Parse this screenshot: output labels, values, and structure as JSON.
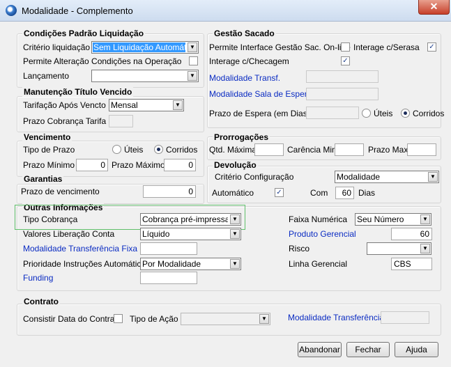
{
  "window": {
    "title": "Modalidade - Complemento",
    "close_glyph": "✕"
  },
  "cond": {
    "title": "Condições Padrão Liquidação",
    "criterio_label": "Critério liquidação",
    "criterio_value": "Sem Liquidação Automática",
    "permite_alteracao_label": "Permite Alteração Condições na Operação",
    "lancamento_label": "Lançamento",
    "lancamento_value": ""
  },
  "manut": {
    "title": "Manutenção Título Vencido",
    "tarifacao_label": "Tarifação Após Vencto",
    "tarifacao_value": "Mensal",
    "prazo_label": "Prazo Cobrança Tarifa",
    "prazo_value": ""
  },
  "venc": {
    "title": "Vencimento",
    "tipo_label": "Tipo de Prazo",
    "uteis_label": "Úteis",
    "corridos_label": "Corridos",
    "prazo_min_label": "Prazo Mínimo",
    "prazo_min_value": "0",
    "prazo_max_label": "Prazo Máximo",
    "prazo_max_value": "0"
  },
  "garantias": {
    "title": "Garantias",
    "prazo_label": "Prazo de vencimento",
    "prazo_value": "0"
  },
  "gestao": {
    "title": "Gestão Sacado",
    "interface_label": "Permite Interface Gestão Sac. On-line",
    "serasa_label": "Interage c/Serasa",
    "checagem_label": "Interage c/Checagem",
    "modalidade_transf_label": "Modalidade Transf.",
    "modalidade_sala_label": "Modalidade Sala de Espera",
    "prazo_espera_label": "Prazo de Espera (em Dias)",
    "uteis_label": "Úteis",
    "corridos_label": "Corridos"
  },
  "prorrog": {
    "title": "Prorrogações",
    "qtd_label": "Qtd. Máxima",
    "carencia_label": "Carência Min.",
    "prazo_label": "Prazo Max."
  },
  "devol": {
    "title": "Devolução",
    "criterio_label": "Critério Configuração",
    "criterio_value": "Modalidade",
    "automatico_label": "Automático",
    "com_label": "Com",
    "com_value": "60",
    "dias_label": "Dias"
  },
  "outras": {
    "title": "Outras Informações",
    "tipo_cobranca_label": "Tipo Cobrança",
    "tipo_cobranca_value": "Cobrança pré-impressa",
    "valores_label": "Valores Liberação Conta",
    "valores_value": "Líquido",
    "modalidade_transf_label": "Modalidade Transferência Fixa",
    "prioridade_label": "Prioridade Instruções Automáticas",
    "prioridade_value": "Por Modalidade",
    "funding_label": "Funding",
    "faixa_label": "Faixa Numérica",
    "faixa_value": "Seu Número",
    "produto_label": "Produto Gerencial",
    "produto_value": "60",
    "risco_label": "Risco",
    "linha_label": "Linha Gerencial",
    "linha_value": "CBS"
  },
  "contrato": {
    "title": "Contrato",
    "consistir_label": "Consistir Data do Contrato",
    "tipo_acao_label": "Tipo de Ação",
    "modalidade_transf_label": "Modalidade Transferência"
  },
  "buttons": {
    "abandonar": "Abandonar",
    "fechar": "Fechar",
    "ajuda": "Ajuda"
  },
  "glyphs": {
    "check": "✓",
    "arrow": "▼"
  }
}
